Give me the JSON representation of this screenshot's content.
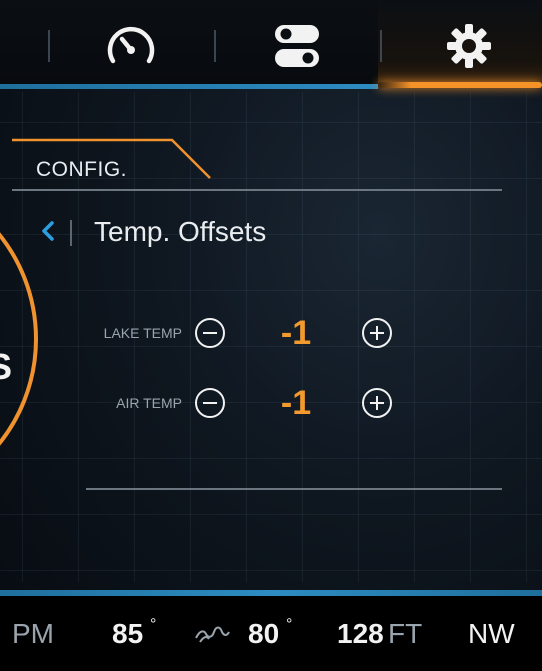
{
  "top_nav": {
    "items": [
      {
        "name": "speedometer-icon"
      },
      {
        "name": "toggles-icon"
      },
      {
        "name": "settings-gear-icon",
        "active": true
      }
    ]
  },
  "config": {
    "tab_label": "CONFIG.",
    "subheader": "Temp. Offsets",
    "back_icon": "chevron-left-icon"
  },
  "gauge": {
    "partial_text": "S"
  },
  "offsets": [
    {
      "label": "LAKE TEMP",
      "value": "-1"
    },
    {
      "label": "AIR TEMP",
      "value": "-1"
    }
  ],
  "status_bar": {
    "time_suffix": "PM",
    "air_temp": "85",
    "water_temp": "80",
    "depth": "128",
    "depth_unit": "FT",
    "heading": "NW",
    "water_icon": "wave-icon"
  },
  "colors": {
    "accent_orange": "#f59228",
    "accent_blue": "#2d8cc2",
    "value_orange": "#f39a2e"
  }
}
